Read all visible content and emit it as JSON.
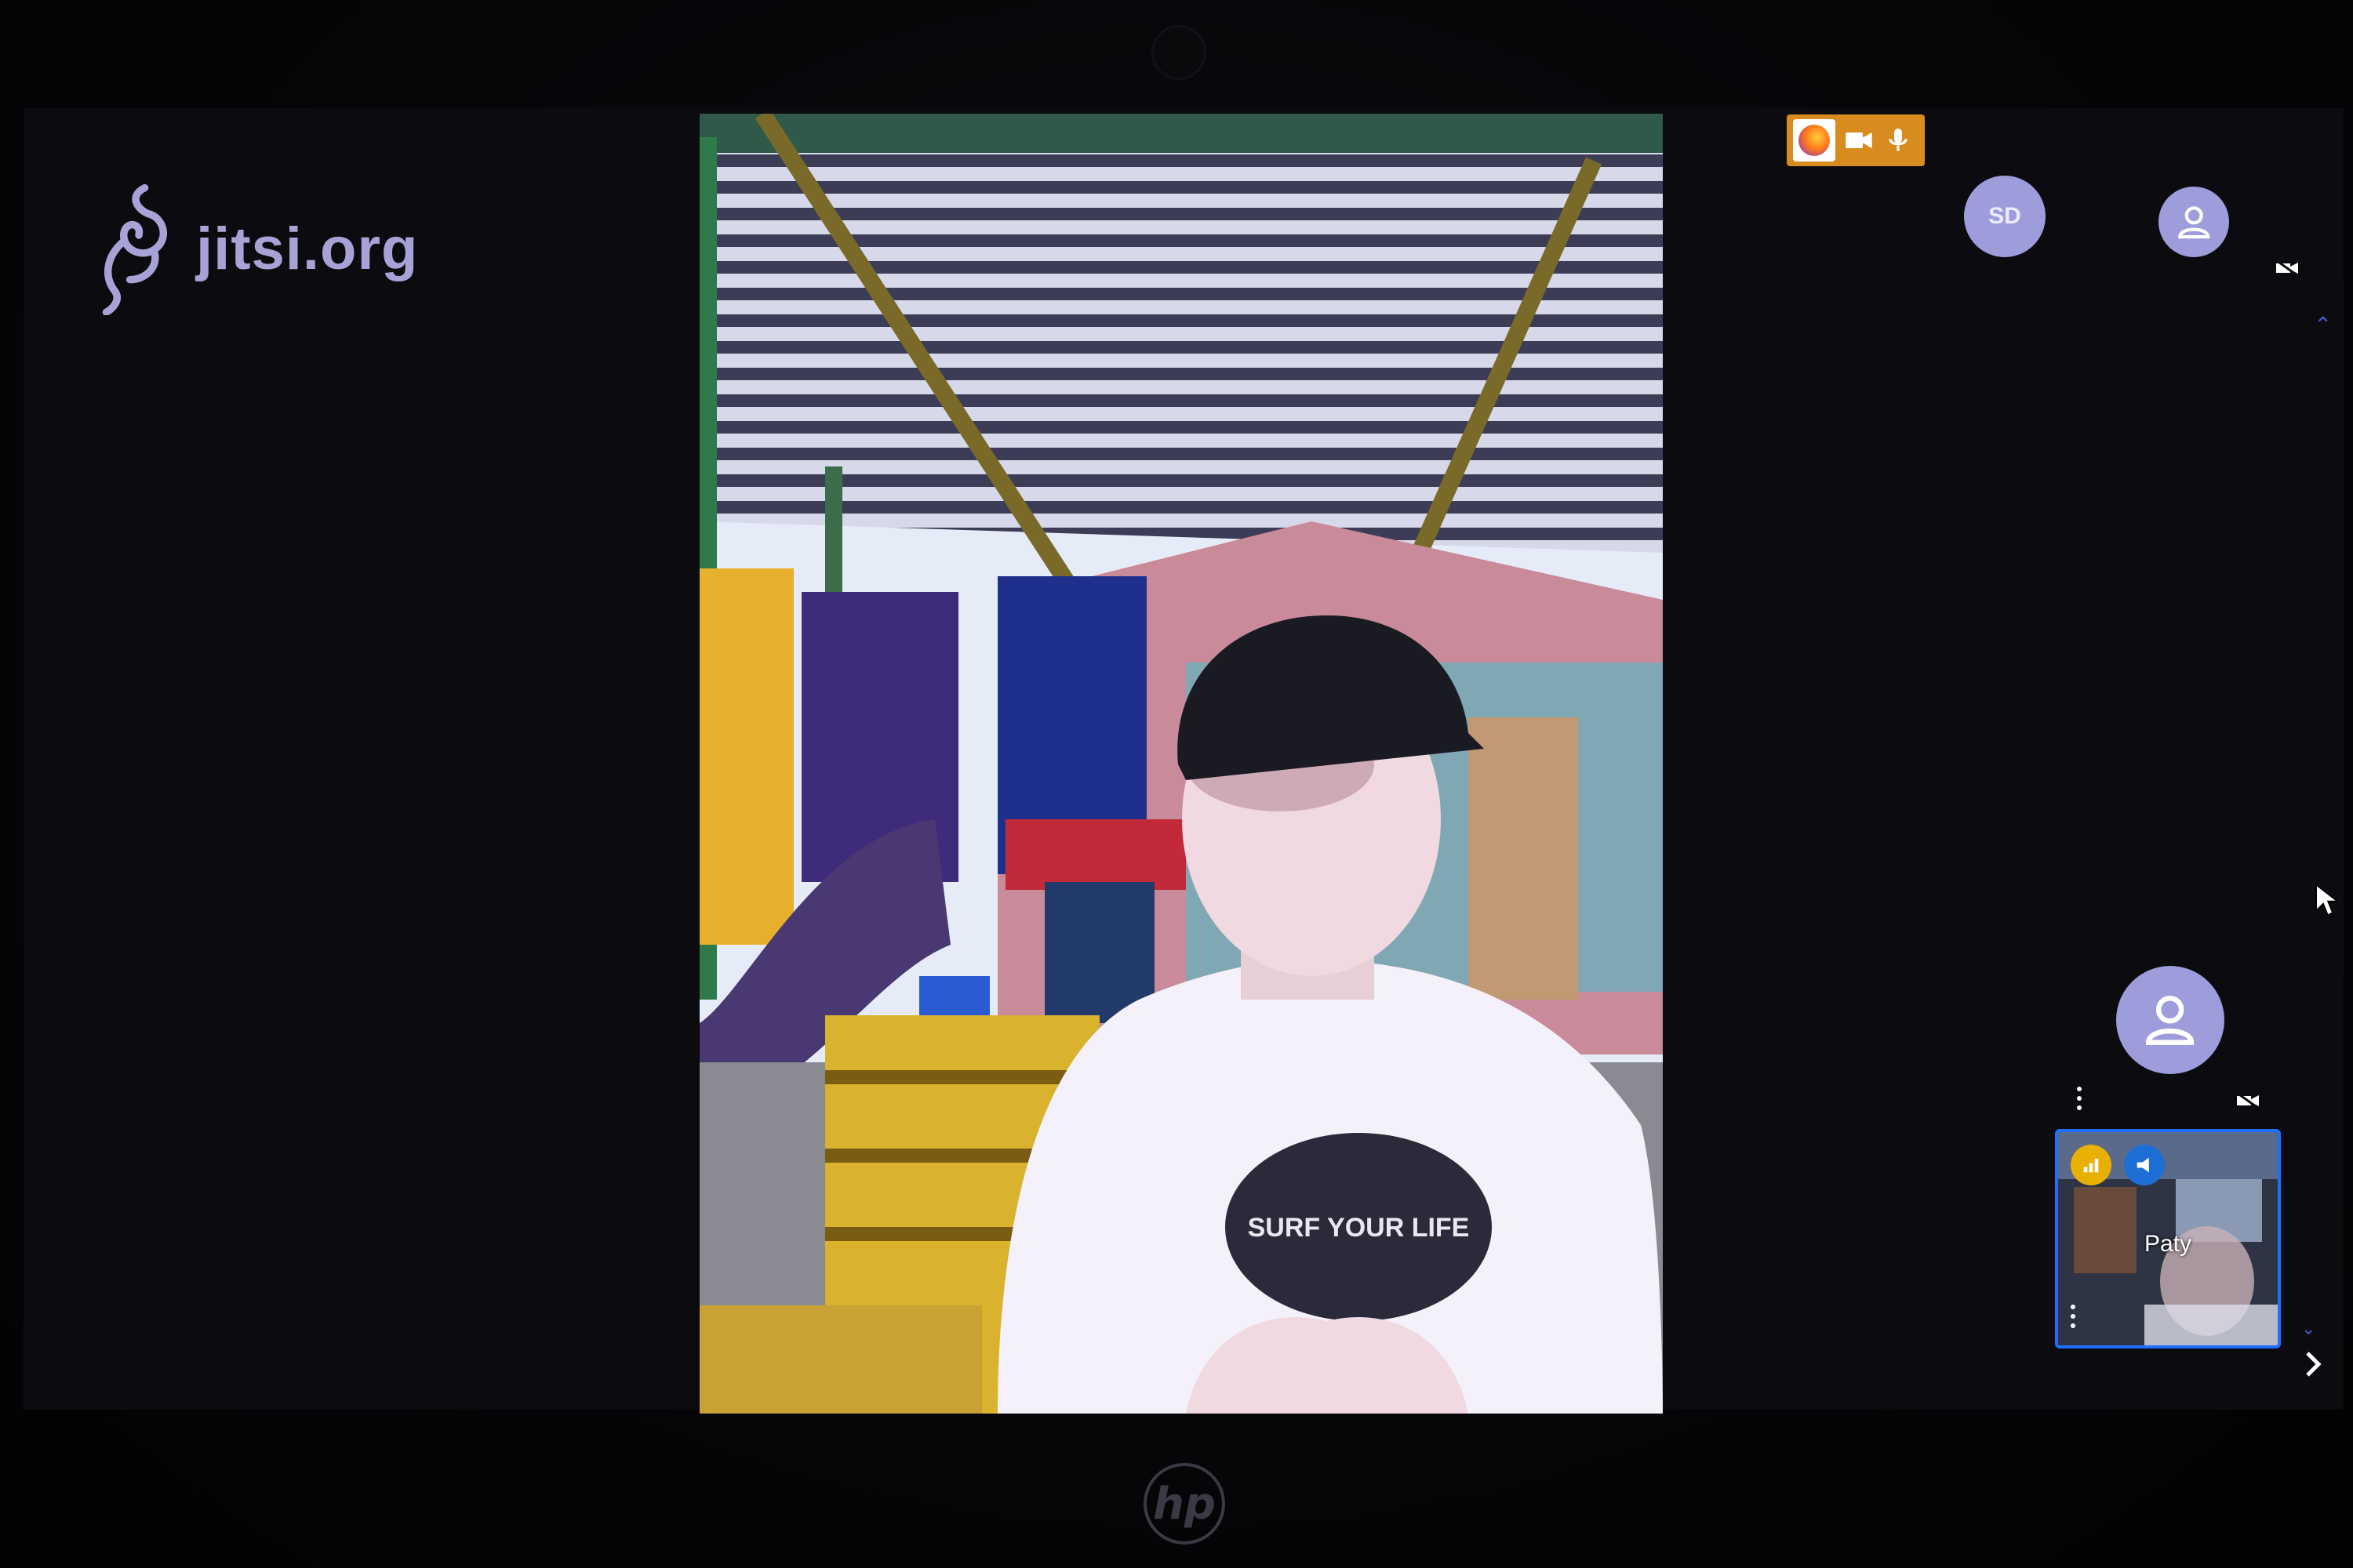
{
  "watermark": {
    "text": "jitsi.org"
  },
  "browser_indicator": {
    "icons": [
      "firefox-icon",
      "camera-icon",
      "microphone-icon"
    ],
    "color": "#d88c1f"
  },
  "filmstrip": {
    "participants": [
      {
        "initials": "SD",
        "type": "initials-avatar"
      },
      {
        "type": "generic-avatar",
        "camera": "off"
      },
      {
        "type": "generic-avatar",
        "camera": "off"
      }
    ],
    "local": {
      "name": "Paty",
      "indicators": [
        "connection-quality-icon",
        "dominant-speaker-icon"
      ],
      "highlight_color": "#1f6fff"
    }
  },
  "main_video": {
    "shirt_text": "SURF YOUR LIFE"
  },
  "hardware": {
    "brand": "hp"
  }
}
